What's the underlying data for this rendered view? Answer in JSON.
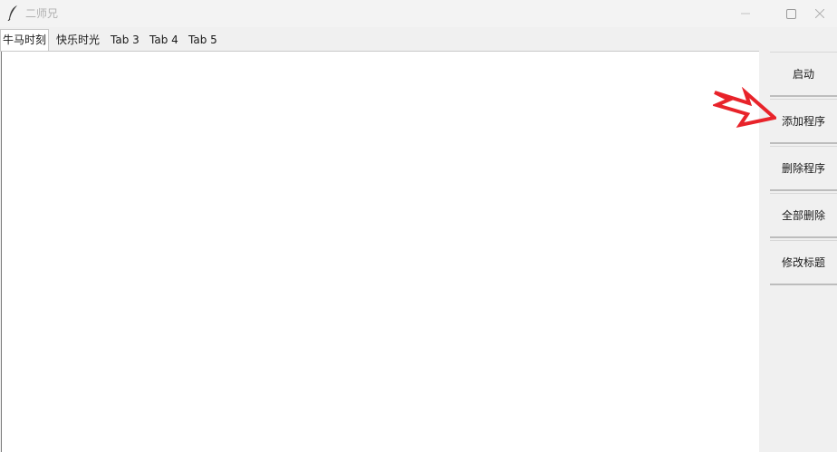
{
  "window": {
    "title": "二师兄",
    "controls": {
      "minimize_icon": "minimize-icon",
      "maximize_icon": "maximize-icon",
      "close_icon": "close-icon"
    }
  },
  "tabs": [
    {
      "label": "牛马时刻",
      "active": true
    },
    {
      "label": "快乐时光",
      "active": false
    },
    {
      "label": "Tab 3",
      "active": false
    },
    {
      "label": "Tab 4",
      "active": false
    },
    {
      "label": "Tab 5",
      "active": false
    }
  ],
  "sidebar": {
    "buttons": [
      {
        "label": "启动"
      },
      {
        "label": "添加程序"
      },
      {
        "label": "删除程序"
      },
      {
        "label": "全部删除"
      },
      {
        "label": "修改标题"
      }
    ]
  },
  "annotation": {
    "arrow_color": "#e8232a",
    "arrow_icon": "red-arrow-icon"
  }
}
